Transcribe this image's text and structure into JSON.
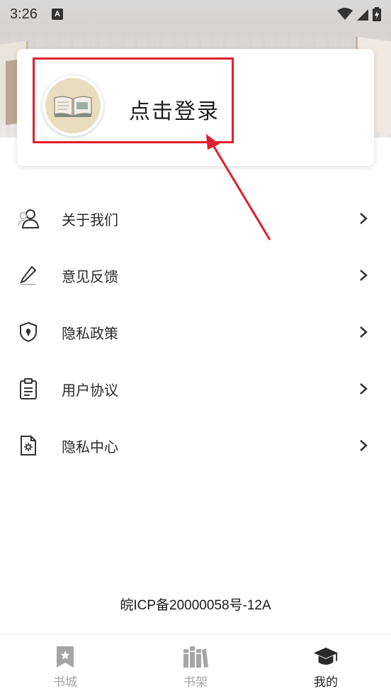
{
  "status_bar": {
    "time": "3:26",
    "notification_letter": "A"
  },
  "login": {
    "label": "点击登录"
  },
  "menu": {
    "items": [
      {
        "label": "关于我们",
        "icon": "users-icon"
      },
      {
        "label": "意见反馈",
        "icon": "pencil-icon"
      },
      {
        "label": "隐私政策",
        "icon": "shield-icon"
      },
      {
        "label": "用户协议",
        "icon": "clipboard-icon"
      },
      {
        "label": "隐私中心",
        "icon": "settings-document-icon"
      }
    ]
  },
  "footer": {
    "icp": "皖ICP备20000058号-12A"
  },
  "bottom_nav": {
    "items": [
      {
        "label": "书城",
        "icon": "bookmark-icon",
        "active": false
      },
      {
        "label": "书架",
        "icon": "bookshelf-icon",
        "active": false
      },
      {
        "label": "我的",
        "icon": "graduation-cap-icon",
        "active": true
      }
    ]
  },
  "colors": {
    "highlight": "#e01e2d",
    "inactive_nav": "#a5a5a5",
    "icon": "#333333"
  }
}
